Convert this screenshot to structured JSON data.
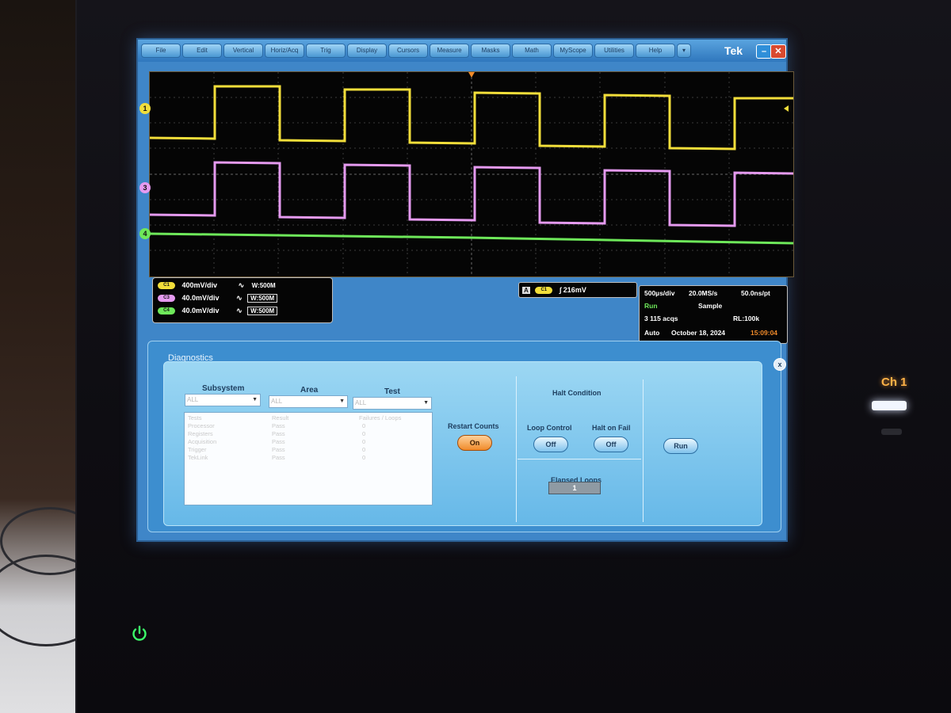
{
  "menu": {
    "items": [
      "File",
      "Edit",
      "Vertical",
      "Horiz/Acq",
      "Trig",
      "Display",
      "Cursors",
      "Measure",
      "Masks",
      "Math",
      "MyScope",
      "Utilities",
      "Help",
      "▾"
    ]
  },
  "brand": "Tek",
  "window_buttons": {
    "minimize": "–",
    "close": "✕"
  },
  "channels": [
    {
      "id": "1",
      "scale": "400mV/div",
      "bw": "500M",
      "color": "#f2de3a"
    },
    {
      "id": "3",
      "scale": "40.0mV/div",
      "bw": "500M",
      "color": "#e59af0"
    },
    {
      "id": "4",
      "scale": "40.0mV/div",
      "bw": "500M",
      "color": "#6ee85a"
    }
  ],
  "readouts": {
    "c1_scale": "400mV/div",
    "c1_bw": "W:500M",
    "c1_tag": "C1",
    "c3_scale": "40.0mV/div",
    "c3_bw": "W:500M",
    "c3_tag": "C3",
    "c4_scale": "40.0mV/div",
    "c4_bw": "W:500M",
    "c4_tag": "C4"
  },
  "trigger": {
    "mode": "A",
    "source": "C1",
    "level": "216mV"
  },
  "acquisition": {
    "timebase": "500µs/div",
    "sample_rate": "20.0MS/s",
    "resolution": "50.0ns/pt",
    "state": "Run",
    "mode": "Sample",
    "acqs": "3 115 acqs",
    "record_length": "RL:100k",
    "trigger_mode": "Auto",
    "date": "October 18, 2024",
    "time": "15:09:04"
  },
  "diagnostics": {
    "title": "Diagnostics",
    "close": "x",
    "subsystem_header": "Subsystem",
    "area_header": "Area",
    "test_header": "Test",
    "subsystem_value": "ALL",
    "area_value": "ALL",
    "test_value": "ALL",
    "results_headers": [
      "Tests",
      "Result",
      "Failures / Loops"
    ],
    "results_rows": [
      [
        "Processor",
        "Pass",
        "0"
      ],
      [
        "Registers",
        "Pass",
        "0"
      ],
      [
        "Acquisition",
        "Pass",
        "0"
      ],
      [
        "Trigger",
        "Pass",
        "0"
      ],
      [
        "TekLink",
        "Pass",
        "0"
      ]
    ],
    "restart_counts_label": "Restart Counts",
    "restart_counts_value": "On",
    "halt_condition_label": "Halt Condition",
    "loop_control_label": "Loop Control",
    "loop_control_value": "Off",
    "halt_on_fail_label": "Halt on Fail",
    "halt_on_fail_value": "Off",
    "elapsed_loops_label": "Elapsed Loops",
    "elapsed_loops_value": "1",
    "run_label": "Run"
  },
  "side_panel": {
    "channel_label": "Ch 1"
  },
  "colors": {
    "ch1": "#f2de3a",
    "ch3": "#e59af0",
    "ch4": "#6ee85a",
    "accent": "#3f86c8"
  }
}
